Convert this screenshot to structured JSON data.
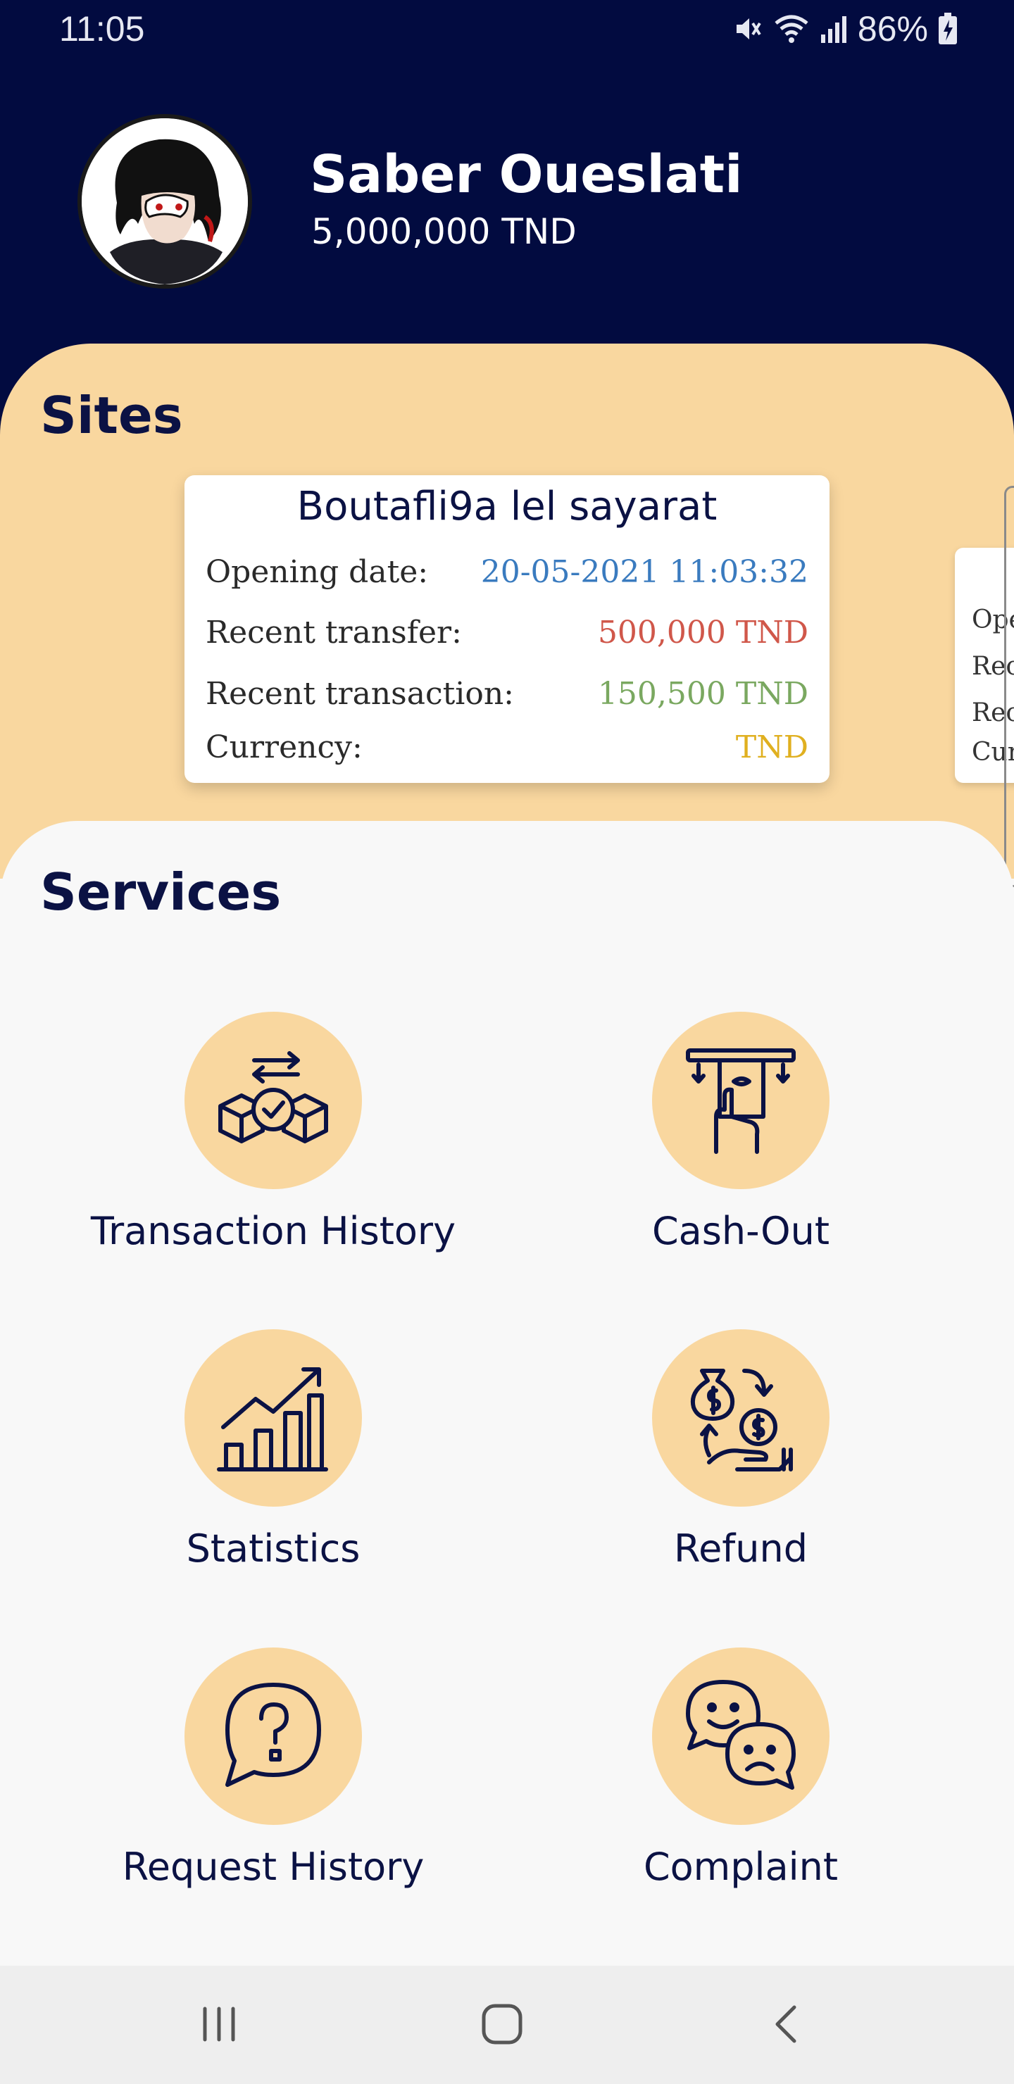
{
  "status_bar": {
    "time": "11:05",
    "battery": "86%",
    "icons": [
      "mute-icon",
      "wifi-icon",
      "signal-icon",
      "battery-charging-icon"
    ]
  },
  "profile": {
    "name": "Saber Oueslati",
    "balance": "5,000,000 TND"
  },
  "sites": {
    "title": "Sites",
    "card": {
      "name": "Boutafli9a lel sayarat",
      "rows": [
        {
          "label": "Opening date:",
          "value": "20-05-2021 11:03:32",
          "color": "#3a7bbf"
        },
        {
          "label": "Recent transfer:",
          "value": "500,000 TND",
          "color": "#d0574a"
        },
        {
          "label": "Recent transaction:",
          "value": "150,500 TND",
          "color": "#7aa860"
        },
        {
          "label": "Currency:",
          "value": "TND",
          "color": "#e0b020"
        }
      ]
    },
    "next_card_labels": [
      "Ope",
      "Rece",
      "Rece",
      "Curr"
    ]
  },
  "services": {
    "title": "Services",
    "items": [
      {
        "label": "Transaction History",
        "icon": "transaction-exchange-icon"
      },
      {
        "label": "Cash-Out",
        "icon": "atm-cash-out-icon"
      },
      {
        "label": "Statistics",
        "icon": "growth-chart-icon"
      },
      {
        "label": "Refund",
        "icon": "money-refund-icon"
      },
      {
        "label": "Request History",
        "icon": "question-bubble-icon"
      },
      {
        "label": "Complaint",
        "icon": "happy-sad-faces-icon"
      }
    ]
  },
  "colors": {
    "header_bg": "#020b40",
    "accent_peach": "#f9d79f",
    "text_navy": "#0b1244",
    "services_bg": "#f8f8f8"
  },
  "nav": {
    "buttons": [
      "recent-apps-icon",
      "home-icon",
      "back-icon"
    ]
  }
}
